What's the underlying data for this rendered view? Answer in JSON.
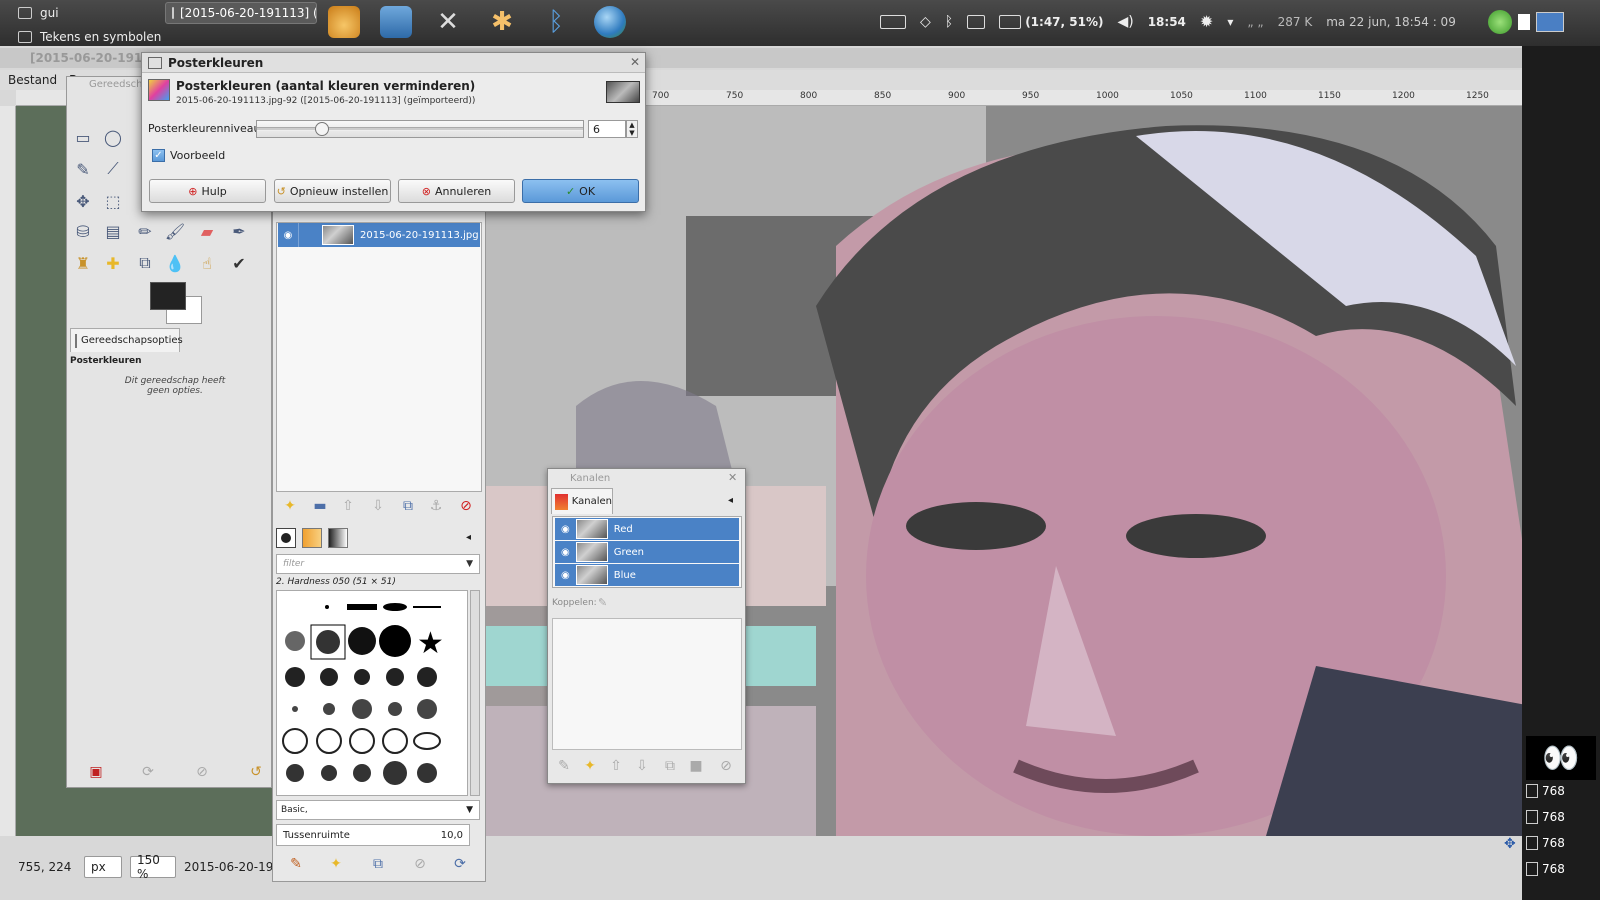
{
  "top_panel": {
    "app_menu_1": "gui",
    "app_menu_2": "Tekens en symbolen",
    "task_title": "[2015-06-20-191113] (...",
    "battery": "(1:47, 51%)",
    "clock": "18:54",
    "net_speed": "287 K",
    "datetime": "ma 22 jun, 18:54 : 09",
    "launchers": [
      "installer-icon",
      "home-folder-icon",
      "tools-icon",
      "star-icon",
      "bluetooth-app-icon",
      "globe-icon"
    ]
  },
  "image_window": {
    "title": "[2015-06-20-191113",
    "menu": [
      "Bestand",
      "B"
    ],
    "ruler_ticks": [
      "700",
      "750",
      "800",
      "850",
      "900",
      "950",
      "1000",
      "1050",
      "1100",
      "1150",
      "1200",
      "1250"
    ],
    "status_coords": "755, 224",
    "unit": "px",
    "zoom": "150 %",
    "status_file": "2015-06-20-191113..."
  },
  "toolbox": {
    "title": "Gereedsch",
    "tab_label": "Gereedschapsopties",
    "options_title": "Posterkleuren",
    "options_text_1": "Dit gereedschap heeft",
    "options_text_2": "geen opties."
  },
  "layers": {
    "layer_name": "2015-06-20-191113.jpg"
  },
  "brushes": {
    "filter_placeholder": "filter",
    "brush_name": "2. Hardness 050 (51 × 51)",
    "preset": "Basic,",
    "spacing_label": "Tussenruimte",
    "spacing_value": "10,0"
  },
  "channels": {
    "title": "Kanalen",
    "tab_label": "Kanalen",
    "items": [
      "Red",
      "Green",
      "Blue"
    ],
    "link_label": "Koppelen:"
  },
  "dialog": {
    "title": "Posterkleuren",
    "heading": "Posterkleuren (aantal kleuren verminderen)",
    "subheading": "2015-06-20-191113.jpg-92 ([2015-06-20-191113] (geïmporteerd))",
    "level_label": "Posterkleurenniveaus:",
    "level_value": "6",
    "level_fraction": 0.2,
    "preview_label": "Voorbeeld",
    "preview_checked": true,
    "btn_help": "Hulp",
    "btn_reset": "Opnieuw instellen",
    "btn_cancel": "Annuleren",
    "btn_ok": "OK"
  },
  "right_panel": {
    "items": [
      "768",
      "768",
      "768",
      "768"
    ]
  },
  "colors": {
    "selection": "#4a82c6",
    "fg_color": "#232323",
    "bg_color": "#ffffff"
  }
}
